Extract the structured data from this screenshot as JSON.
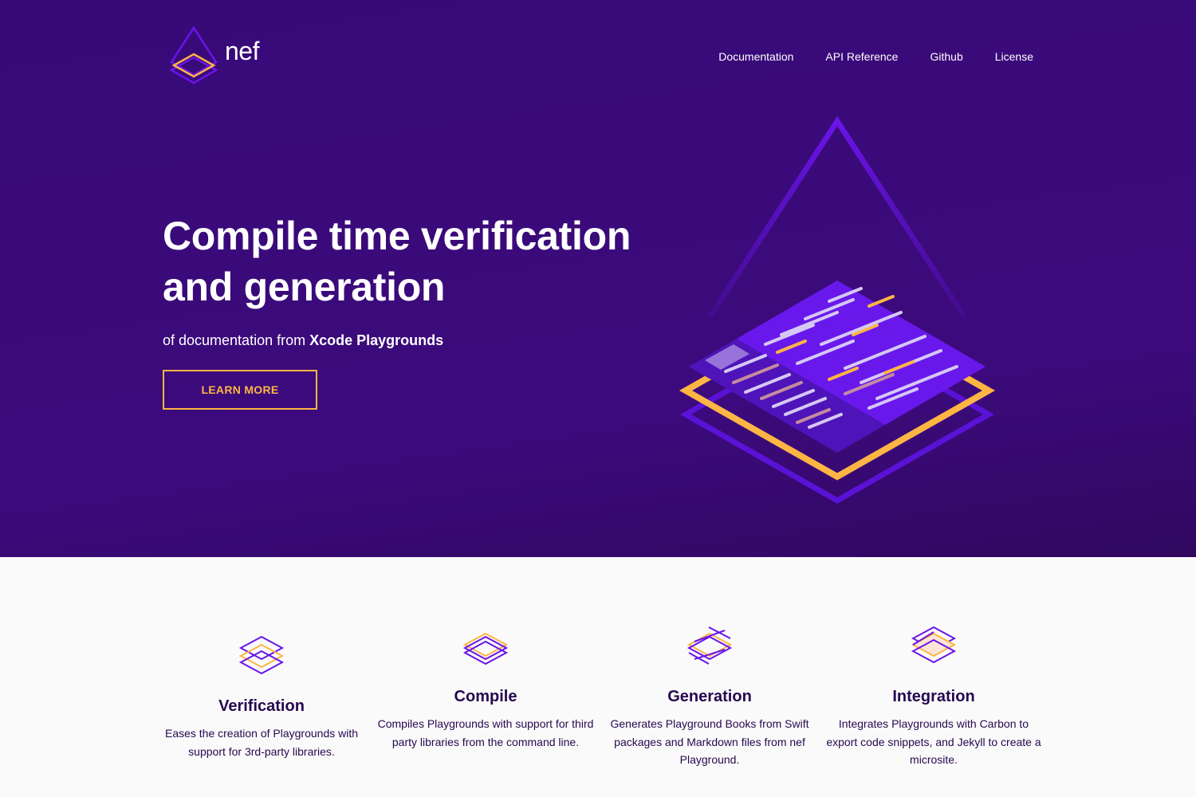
{
  "brand": {
    "name": "nef"
  },
  "nav": {
    "items": [
      {
        "label": "Documentation"
      },
      {
        "label": "API Reference"
      },
      {
        "label": "Github"
      },
      {
        "label": "License"
      }
    ]
  },
  "hero": {
    "title_line1": "Compile time verification",
    "title_line2": "and generation",
    "subtitle_prefix": "of documentation from ",
    "subtitle_bold": "Xcode Playgrounds",
    "cta_label": "LEARN MORE"
  },
  "features": [
    {
      "icon": "layers-verification-icon",
      "title": "Verification",
      "description": "Eases the creation of Playgrounds with support for 3rd-party libraries."
    },
    {
      "icon": "layers-compile-icon",
      "title": "Compile",
      "description": "Compiles Playgrounds with support for third party libraries from the command line."
    },
    {
      "icon": "layers-generation-icon",
      "title": "Generation",
      "description": "Generates Playground Books from Swift packages and Markdown files from nef Playground."
    },
    {
      "icon": "layers-integration-icon",
      "title": "Integration",
      "description": "Integrates Playgrounds with Carbon to export code snippets, and Jekyll to create a microsite."
    }
  ],
  "colors": {
    "hero_background": "#3a0a7a",
    "accent_orange": "#fdb544",
    "accent_purple": "#6a14e8",
    "heading_dark": "#26084f",
    "page_background": "#fafafa"
  }
}
